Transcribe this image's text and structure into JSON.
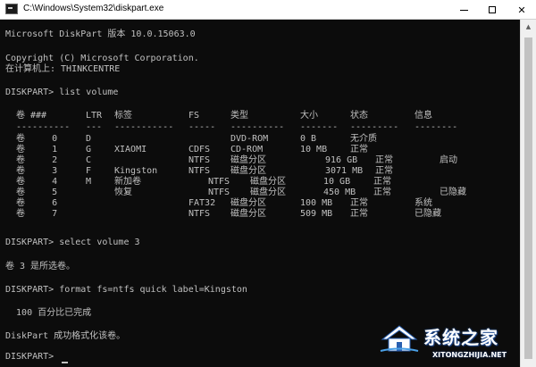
{
  "window": {
    "title": "C:\\Windows\\System32\\diskpart.exe",
    "icons": {
      "app": "console-icon",
      "minimize": "minimize-icon",
      "maximize": "maximize-icon",
      "close": "close-icon"
    },
    "close_glyph": "✕"
  },
  "console": {
    "header_lines": [
      "Microsoft DiskPart 版本 10.0.15063.0",
      "Copyright (C) Microsoft Corporation.",
      "在计算机上: THINKCENTRE"
    ],
    "cmd_list": "DISKPART> list volume",
    "volume_table": {
      "headers": [
        "卷 ###",
        "LTR",
        "标签",
        "FS",
        "类型",
        "大小",
        "状态",
        "信息"
      ],
      "separators": [
        "----------",
        "---",
        "-----------",
        "-----",
        "----------",
        "-------",
        "---------",
        "--------"
      ],
      "rows": [
        [
          "卷     0",
          "D",
          "",
          "",
          "DVD-ROM",
          "0 B",
          "无介质",
          ""
        ],
        [
          "卷     1",
          "G",
          "XIAOMI",
          "CDFS",
          "CD-ROM",
          "10 MB",
          "正常",
          ""
        ],
        [
          "卷     2",
          "C",
          "",
          "NTFS",
          "磁盘分区",
          "916 GB",
          "正常",
          "启动"
        ],
        [
          "卷     3",
          "F",
          "Kingston",
          "NTFS",
          "磁盘分区",
          "3071 MB",
          "正常",
          ""
        ],
        [
          "卷     4",
          "M",
          "新加卷",
          "NTFS",
          "磁盘分区",
          "10 GB",
          "正常",
          ""
        ],
        [
          "卷     5",
          "",
          "恢复",
          "NTFS",
          "磁盘分区",
          "450 MB",
          "正常",
          "已隐藏"
        ],
        [
          "卷     6",
          "",
          "",
          "FAT32",
          "磁盘分区",
          "100 MB",
          "正常",
          "系统"
        ],
        [
          "卷     7",
          "",
          "",
          "NTFS",
          "磁盘分区",
          "509 MB",
          "正常",
          "已隐藏"
        ]
      ]
    },
    "cmd_select": "DISKPART> select volume 3",
    "select_result": "卷 3 是所选卷。",
    "cmd_format": "DISKPART> format fs=ntfs quick label=Kingston",
    "format_progress": "  100 百分比已完成",
    "format_result": "DiskPart 成功格式化该卷。",
    "prompt": "DISKPART> "
  },
  "scrollbar": {
    "up_glyph": "▲"
  },
  "watermark": {
    "logo": "house-logo-icon",
    "text": "系统之家",
    "url": "XITONGZHIJIA.NET"
  }
}
